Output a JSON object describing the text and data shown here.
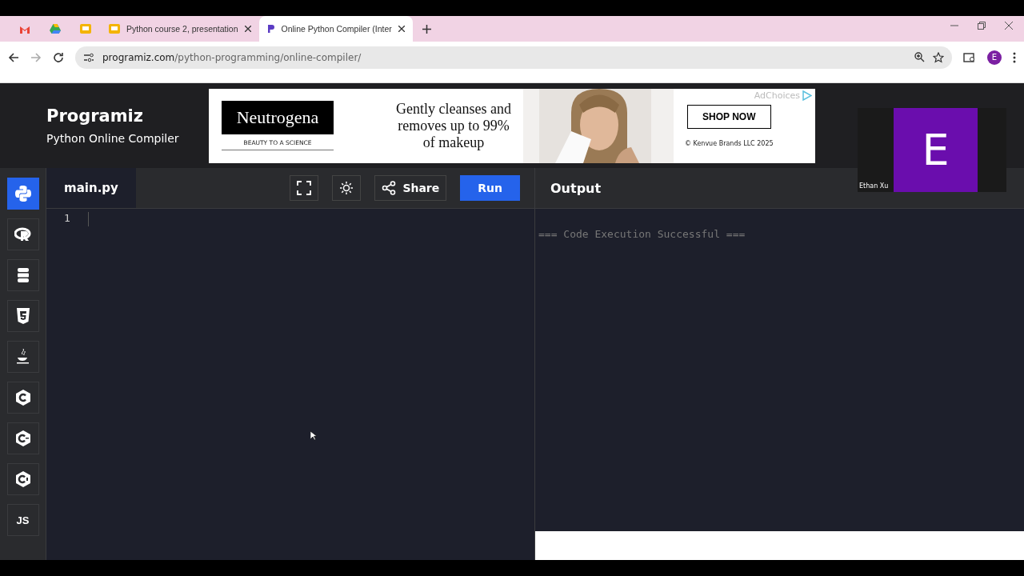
{
  "browser": {
    "tabs": [
      {
        "kind": "gmail",
        "selected": false
      },
      {
        "kind": "drive",
        "selected": false
      },
      {
        "kind": "slides",
        "selected": false
      },
      {
        "kind": "slides",
        "title": "Python course 2, presentation",
        "selected": false
      },
      {
        "kind": "programiz",
        "title": "Online Python Compiler (Inter",
        "selected": true
      }
    ],
    "url_host": "programiz.com",
    "url_path": "/python-programming/online-compiler/",
    "profile_initial": "E"
  },
  "header": {
    "brand": "Programiz",
    "subtitle": "Python Online Compiler"
  },
  "ad": {
    "brand": "Neutrogena",
    "tagline": "BEAUTY TO A SCIENCE",
    "headline": "Gently cleanses and removes up to 99% of makeup",
    "cta": "SHOP NOW",
    "legal": "© Kenvue Brands LLC 2025",
    "adchoices": "AdChoices"
  },
  "sidebar": {
    "items": [
      {
        "kind": "python",
        "selected": true
      },
      {
        "kind": "r",
        "selected": false
      },
      {
        "kind": "database",
        "selected": false
      },
      {
        "kind": "html",
        "selected": false
      },
      {
        "kind": "java",
        "selected": false
      },
      {
        "kind": "c",
        "selected": false
      },
      {
        "kind": "cpp",
        "selected": false
      },
      {
        "kind": "csharp",
        "selected": false
      },
      {
        "kind": "js",
        "label": "JS",
        "selected": false
      }
    ]
  },
  "editor": {
    "file_tab": "main.py",
    "line_numbers": [
      "1"
    ],
    "share": "Share",
    "run": "Run"
  },
  "output": {
    "title": "Output",
    "lines": [
      "=== Code Execution Successful ==="
    ]
  },
  "video_tile": {
    "initial": "E",
    "name": "Ethan Xu"
  }
}
